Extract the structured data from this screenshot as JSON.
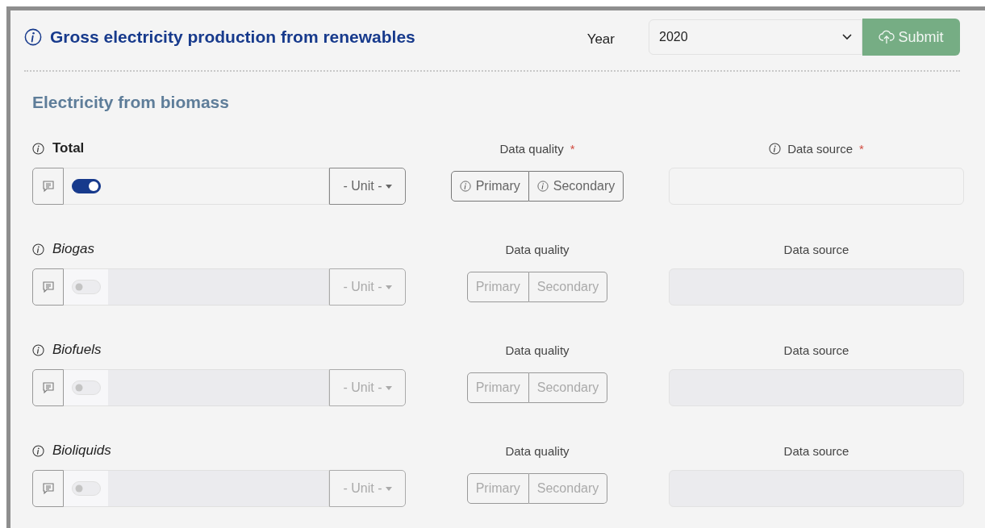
{
  "header": {
    "title": "Gross electricity production from renewables",
    "year_label": "Year",
    "year_value": "2020",
    "submit": "Submit"
  },
  "section": {
    "title": "Electricity from biomass"
  },
  "rows": [
    {
      "label": "Total",
      "kind": "total",
      "on": true,
      "disabled": false,
      "quality_mark": "*",
      "source_mark": "*",
      "unit": "- Unit -",
      "quality_label": "Data quality",
      "source_label": "Data source",
      "options": [
        {
          "label": "Primary",
          "selected": false
        },
        {
          "label": "Secondary",
          "selected": false
        }
      ]
    },
    {
      "label": "Biogas",
      "kind": "sub",
      "on": false,
      "disabled": true,
      "unit": "- Unit -",
      "quality_label": "Data quality",
      "source_label": "Data source",
      "options": [
        {
          "label": "Primary",
          "selected": false
        },
        {
          "label": "Secondary",
          "selected": false
        }
      ]
    },
    {
      "label": "Biofuels",
      "kind": "sub",
      "on": false,
      "disabled": true,
      "unit": "- Unit -",
      "quality_label": "Data quality",
      "source_label": "Data source",
      "options": [
        {
          "label": "Primary",
          "selected": false
        },
        {
          "label": "Secondary",
          "selected": false
        }
      ]
    },
    {
      "label": "Bioliquids",
      "kind": "sub",
      "on": false,
      "disabled": true,
      "unit": "- Unit -",
      "quality_label": "Data quality",
      "source_label": "Data source",
      "options": [
        {
          "label": "Primary",
          "selected": false
        },
        {
          "label": "Secondary",
          "selected": false
        }
      ]
    }
  ]
}
